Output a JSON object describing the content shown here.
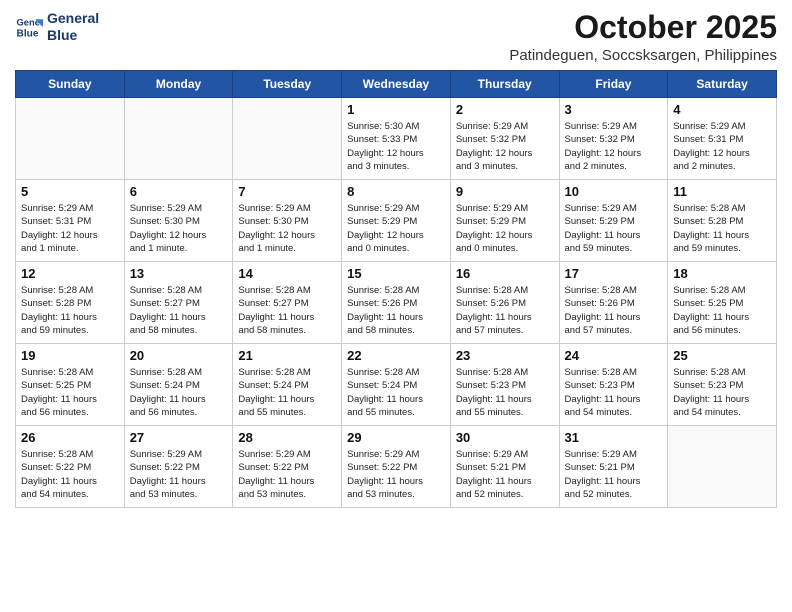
{
  "header": {
    "logo_line1": "General",
    "logo_line2": "Blue",
    "month": "October 2025",
    "location": "Patindeguen, Soccsksargen, Philippines"
  },
  "days": [
    "Sunday",
    "Monday",
    "Tuesday",
    "Wednesday",
    "Thursday",
    "Friday",
    "Saturday"
  ],
  "weeks": [
    [
      {
        "date": "",
        "info": ""
      },
      {
        "date": "",
        "info": ""
      },
      {
        "date": "",
        "info": ""
      },
      {
        "date": "1",
        "info": "Sunrise: 5:30 AM\nSunset: 5:33 PM\nDaylight: 12 hours\nand 3 minutes."
      },
      {
        "date": "2",
        "info": "Sunrise: 5:29 AM\nSunset: 5:32 PM\nDaylight: 12 hours\nand 3 minutes."
      },
      {
        "date": "3",
        "info": "Sunrise: 5:29 AM\nSunset: 5:32 PM\nDaylight: 12 hours\nand 2 minutes."
      },
      {
        "date": "4",
        "info": "Sunrise: 5:29 AM\nSunset: 5:31 PM\nDaylight: 12 hours\nand 2 minutes."
      }
    ],
    [
      {
        "date": "5",
        "info": "Sunrise: 5:29 AM\nSunset: 5:31 PM\nDaylight: 12 hours\nand 1 minute."
      },
      {
        "date": "6",
        "info": "Sunrise: 5:29 AM\nSunset: 5:30 PM\nDaylight: 12 hours\nand 1 minute."
      },
      {
        "date": "7",
        "info": "Sunrise: 5:29 AM\nSunset: 5:30 PM\nDaylight: 12 hours\nand 1 minute."
      },
      {
        "date": "8",
        "info": "Sunrise: 5:29 AM\nSunset: 5:29 PM\nDaylight: 12 hours\nand 0 minutes."
      },
      {
        "date": "9",
        "info": "Sunrise: 5:29 AM\nSunset: 5:29 PM\nDaylight: 12 hours\nand 0 minutes."
      },
      {
        "date": "10",
        "info": "Sunrise: 5:29 AM\nSunset: 5:29 PM\nDaylight: 11 hours\nand 59 minutes."
      },
      {
        "date": "11",
        "info": "Sunrise: 5:28 AM\nSunset: 5:28 PM\nDaylight: 11 hours\nand 59 minutes."
      }
    ],
    [
      {
        "date": "12",
        "info": "Sunrise: 5:28 AM\nSunset: 5:28 PM\nDaylight: 11 hours\nand 59 minutes."
      },
      {
        "date": "13",
        "info": "Sunrise: 5:28 AM\nSunset: 5:27 PM\nDaylight: 11 hours\nand 58 minutes."
      },
      {
        "date": "14",
        "info": "Sunrise: 5:28 AM\nSunset: 5:27 PM\nDaylight: 11 hours\nand 58 minutes."
      },
      {
        "date": "15",
        "info": "Sunrise: 5:28 AM\nSunset: 5:26 PM\nDaylight: 11 hours\nand 58 minutes."
      },
      {
        "date": "16",
        "info": "Sunrise: 5:28 AM\nSunset: 5:26 PM\nDaylight: 11 hours\nand 57 minutes."
      },
      {
        "date": "17",
        "info": "Sunrise: 5:28 AM\nSunset: 5:26 PM\nDaylight: 11 hours\nand 57 minutes."
      },
      {
        "date": "18",
        "info": "Sunrise: 5:28 AM\nSunset: 5:25 PM\nDaylight: 11 hours\nand 56 minutes."
      }
    ],
    [
      {
        "date": "19",
        "info": "Sunrise: 5:28 AM\nSunset: 5:25 PM\nDaylight: 11 hours\nand 56 minutes."
      },
      {
        "date": "20",
        "info": "Sunrise: 5:28 AM\nSunset: 5:24 PM\nDaylight: 11 hours\nand 56 minutes."
      },
      {
        "date": "21",
        "info": "Sunrise: 5:28 AM\nSunset: 5:24 PM\nDaylight: 11 hours\nand 55 minutes."
      },
      {
        "date": "22",
        "info": "Sunrise: 5:28 AM\nSunset: 5:24 PM\nDaylight: 11 hours\nand 55 minutes."
      },
      {
        "date": "23",
        "info": "Sunrise: 5:28 AM\nSunset: 5:23 PM\nDaylight: 11 hours\nand 55 minutes."
      },
      {
        "date": "24",
        "info": "Sunrise: 5:28 AM\nSunset: 5:23 PM\nDaylight: 11 hours\nand 54 minutes."
      },
      {
        "date": "25",
        "info": "Sunrise: 5:28 AM\nSunset: 5:23 PM\nDaylight: 11 hours\nand 54 minutes."
      }
    ],
    [
      {
        "date": "26",
        "info": "Sunrise: 5:28 AM\nSunset: 5:22 PM\nDaylight: 11 hours\nand 54 minutes."
      },
      {
        "date": "27",
        "info": "Sunrise: 5:29 AM\nSunset: 5:22 PM\nDaylight: 11 hours\nand 53 minutes."
      },
      {
        "date": "28",
        "info": "Sunrise: 5:29 AM\nSunset: 5:22 PM\nDaylight: 11 hours\nand 53 minutes."
      },
      {
        "date": "29",
        "info": "Sunrise: 5:29 AM\nSunset: 5:22 PM\nDaylight: 11 hours\nand 53 minutes."
      },
      {
        "date": "30",
        "info": "Sunrise: 5:29 AM\nSunset: 5:21 PM\nDaylight: 11 hours\nand 52 minutes."
      },
      {
        "date": "31",
        "info": "Sunrise: 5:29 AM\nSunset: 5:21 PM\nDaylight: 11 hours\nand 52 minutes."
      },
      {
        "date": "",
        "info": ""
      }
    ]
  ]
}
